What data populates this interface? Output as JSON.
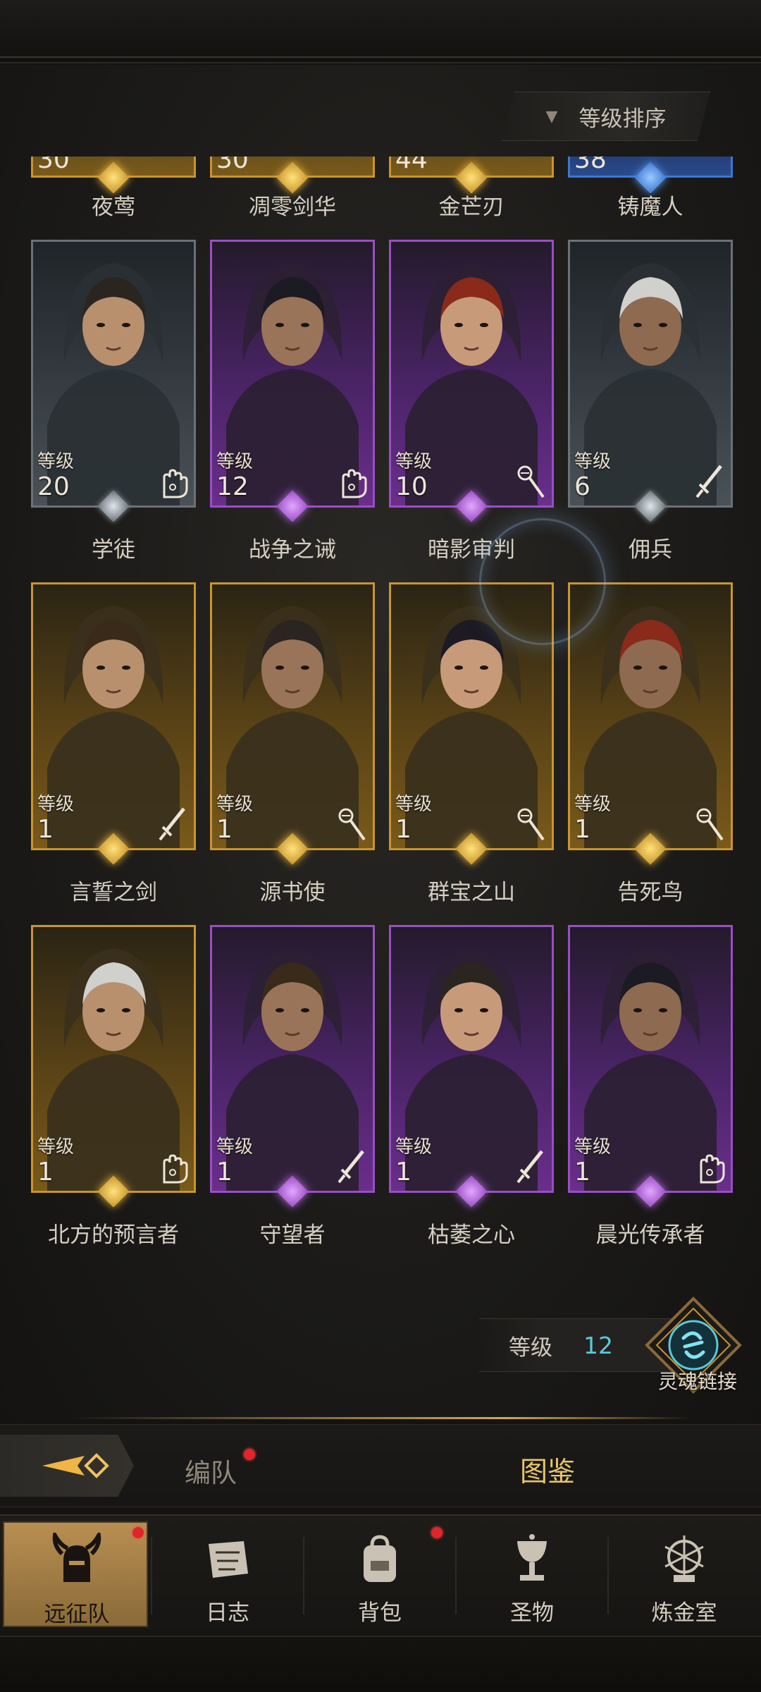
{
  "sort": {
    "label": "等级排序",
    "icon": "triangle-down-icon"
  },
  "partial_row": [
    {
      "name": "夜莺",
      "level": "30",
      "rarity": "gold"
    },
    {
      "name": "凋零剑华",
      "level": "30",
      "rarity": "gold"
    },
    {
      "name": "金芒刃",
      "level": "44",
      "rarity": "gold"
    },
    {
      "name": "铸魔人",
      "level": "38",
      "rarity": "blue"
    }
  ],
  "level_label": "等级",
  "heroes": [
    {
      "name": "学徒",
      "level": "20",
      "rarity": "gray",
      "role": "hand-icon"
    },
    {
      "name": "战争之诫",
      "level": "12",
      "rarity": "purple",
      "role": "hand-icon"
    },
    {
      "name": "暗影审判",
      "level": "10",
      "rarity": "purple",
      "role": "staff-icon"
    },
    {
      "name": "佣兵",
      "level": "6",
      "rarity": "gray",
      "role": "sword-icon"
    },
    {
      "name": "言誓之剑",
      "level": "1",
      "rarity": "gold",
      "role": "sword-icon"
    },
    {
      "name": "源书使",
      "level": "1",
      "rarity": "gold",
      "role": "staff-icon"
    },
    {
      "name": "群宝之山",
      "level": "1",
      "rarity": "gold",
      "role": "staff-icon"
    },
    {
      "name": "告死鸟",
      "level": "1",
      "rarity": "gold",
      "role": "staff-icon"
    },
    {
      "name": "北方的预言者",
      "level": "1",
      "rarity": "gold",
      "role": "hand-icon"
    },
    {
      "name": "守望者",
      "level": "1",
      "rarity": "purple",
      "role": "sword-icon"
    },
    {
      "name": "枯萎之心",
      "level": "1",
      "rarity": "purple",
      "role": "sword-icon"
    },
    {
      "name": "晨光传承者",
      "level": "1",
      "rarity": "purple",
      "role": "hand-icon"
    }
  ],
  "soul_link": {
    "level_label": "等级",
    "level_value": "12",
    "label": "灵魂链接"
  },
  "subtabs": {
    "formation": "编队",
    "codex": "图鉴"
  },
  "nav": [
    {
      "label": "远征队",
      "icon": "horned-helmet-icon"
    },
    {
      "label": "日志",
      "icon": "scroll-icon"
    },
    {
      "label": "背包",
      "icon": "backpack-icon"
    },
    {
      "label": "圣物",
      "icon": "chalice-icon"
    },
    {
      "label": "炼金室",
      "icon": "alchemy-icon"
    }
  ],
  "colors": {
    "gold": "#c9952e",
    "purple": "#9a4ec4",
    "gray": "#6a7278",
    "blue": "#3b78d2",
    "accent": "#57c9dd",
    "active_tab": "#e9c66a"
  }
}
